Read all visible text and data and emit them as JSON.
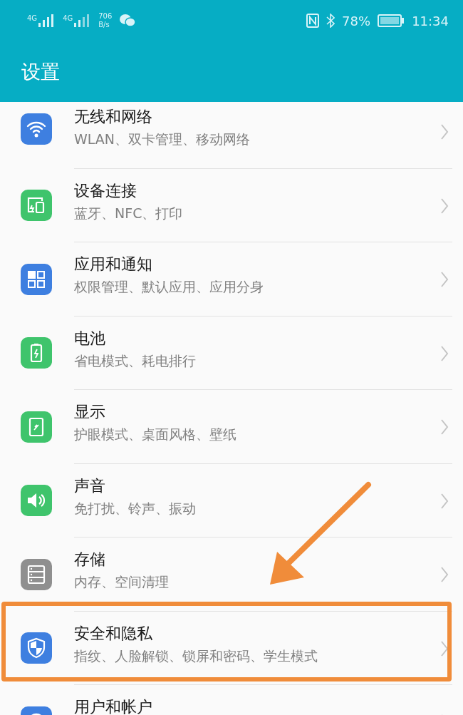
{
  "status_bar": {
    "sim_1": "4G",
    "sim_2": "4G",
    "speed_value": "706",
    "speed_unit": "B/s",
    "battery": "78%",
    "time": "11:34"
  },
  "header": {
    "title": "设置"
  },
  "items": [
    {
      "title": "无线和网络",
      "subtitle": "WLAN、双卡管理、移动网络",
      "color": "#3e7fe0",
      "highlighted": false
    },
    {
      "title": "设备连接",
      "subtitle": "蓝牙、NFC、打印",
      "color": "#3fc46c",
      "highlighted": false
    },
    {
      "title": "应用和通知",
      "subtitle": "权限管理、默认应用、应用分身",
      "color": "#3e7fe0",
      "highlighted": false
    },
    {
      "title": "电池",
      "subtitle": "省电模式、耗电排行",
      "color": "#3fc46c",
      "highlighted": false
    },
    {
      "title": "显示",
      "subtitle": "护眼模式、桌面风格、壁纸",
      "color": "#3fc46c",
      "highlighted": false
    },
    {
      "title": "声音",
      "subtitle": "免打扰、铃声、振动",
      "color": "#3fc46c",
      "highlighted": false
    },
    {
      "title": "存储",
      "subtitle": "内存、空间清理",
      "color": "#8f8f8f",
      "highlighted": false
    },
    {
      "title": "安全和隐私",
      "subtitle": "指纹、人脸解锁、锁屏和密码、学生模式",
      "color": "#3e7fe0",
      "highlighted": true
    },
    {
      "title": "用户和帐户",
      "color": "#3e7fe0",
      "highlighted": false
    }
  ]
}
